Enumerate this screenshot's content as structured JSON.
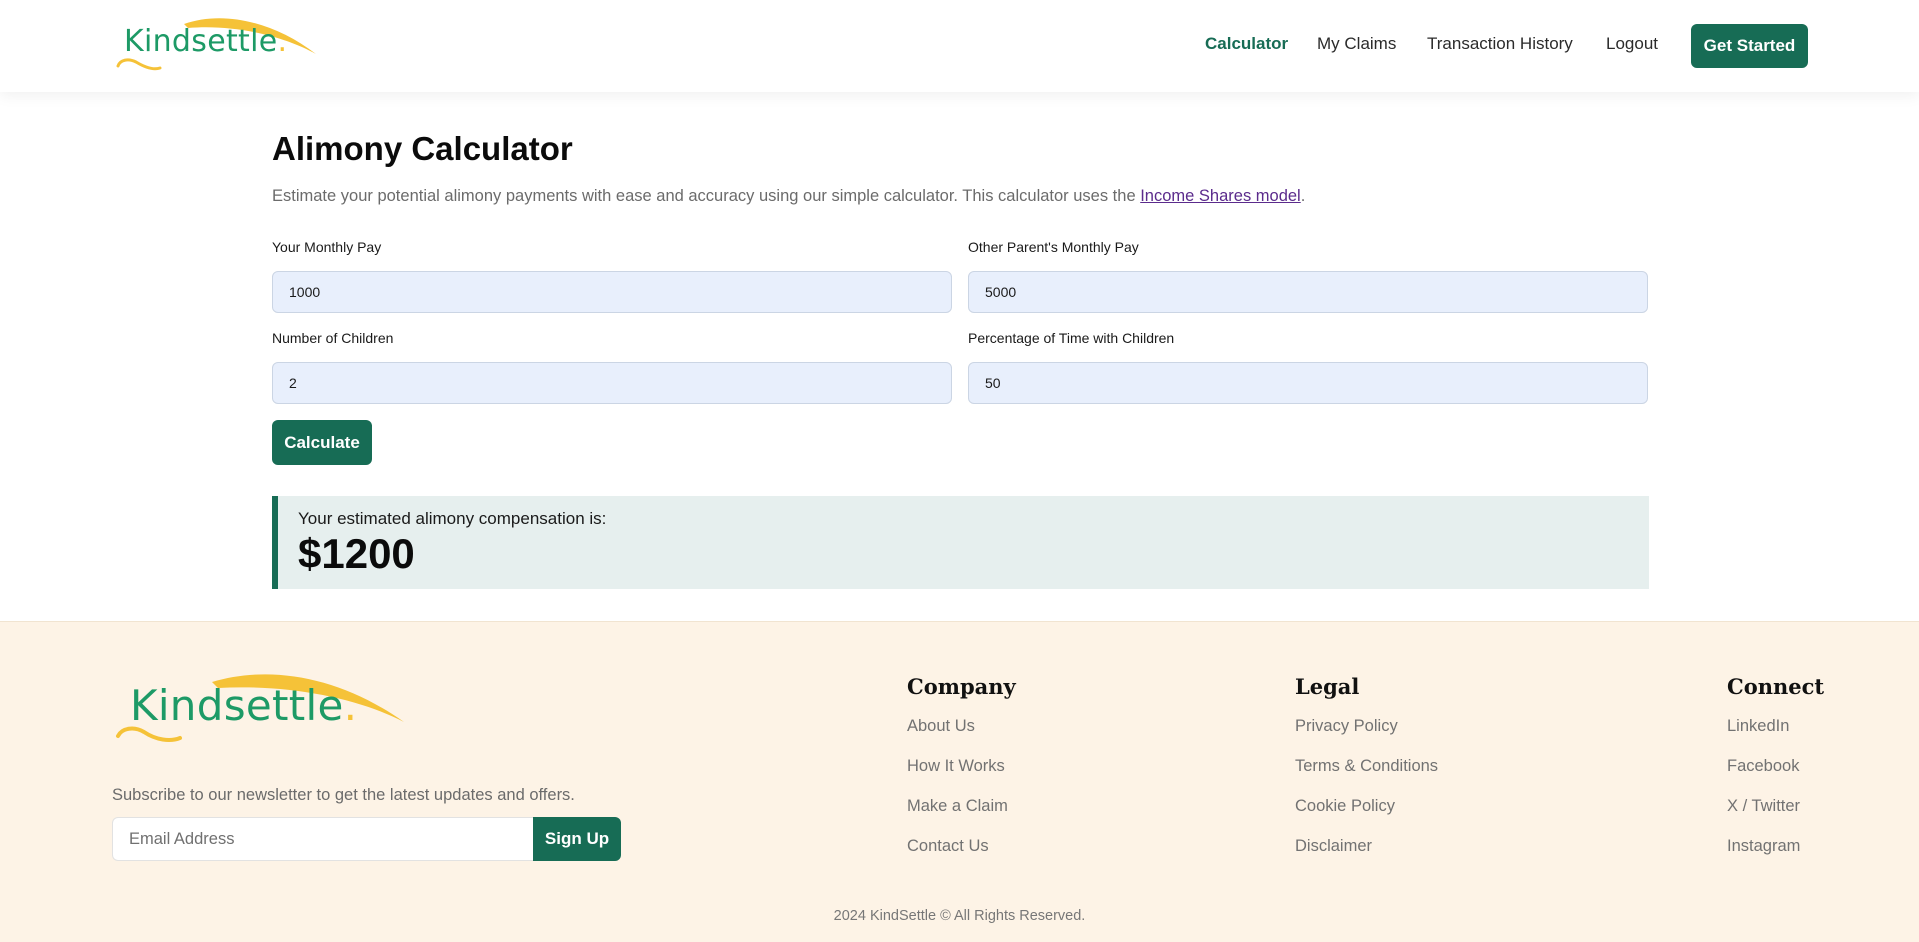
{
  "brand": {
    "name": "Kindsettle",
    "dot": ".",
    "green": "#1d9a66",
    "yellow": "#f5c238",
    "accent": "#176c55"
  },
  "nav": {
    "items": [
      {
        "label": "Calculator",
        "active": true
      },
      {
        "label": "My Claims",
        "active": false
      },
      {
        "label": "Transaction History",
        "active": false
      },
      {
        "label": "Logout",
        "active": false
      }
    ],
    "cta": "Get Started"
  },
  "main": {
    "title": "Alimony Calculator",
    "description_prefix": "Estimate your potential alimony payments with ease and accuracy using our simple calculator. This calculator uses the ",
    "description_link": "Income Shares model",
    "description_suffix": ".",
    "fields": {
      "your_pay": {
        "label": "Your Monthly Pay",
        "value": "1000"
      },
      "other_pay": {
        "label": "Other Parent's Monthly Pay",
        "value": "5000"
      },
      "children": {
        "label": "Number of Children",
        "value": "2"
      },
      "time_pct": {
        "label": "Percentage of Time with Children",
        "value": "50"
      }
    },
    "calculate_label": "Calculate",
    "result": {
      "label": "Your estimated alimony compensation is:",
      "value": "$1200"
    }
  },
  "footer": {
    "newsletter_text": "Subscribe to our newsletter to get the latest updates and offers.",
    "email_placeholder": "Email Address",
    "signup_label": "Sign Up",
    "columns": [
      {
        "heading": "Company",
        "links": [
          "About Us",
          "How It Works",
          "Make a Claim",
          "Contact Us"
        ]
      },
      {
        "heading": "Legal",
        "links": [
          "Privacy Policy",
          "Terms & Conditions",
          "Cookie Policy",
          "Disclaimer"
        ]
      },
      {
        "heading": "Connect",
        "links": [
          "LinkedIn",
          "Facebook",
          "X / Twitter",
          "Instagram"
        ]
      }
    ],
    "copyright": "2024 KindSettle © All Rights Reserved."
  }
}
